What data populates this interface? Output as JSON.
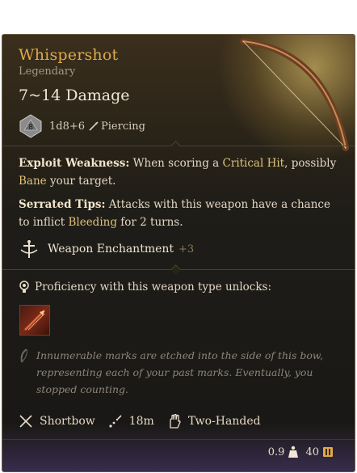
{
  "item": {
    "name": "Whispershot",
    "rarity": "Legendary",
    "damage_range": "7~14 Damage",
    "dice_face": "8",
    "dice_formula": "1d8+6",
    "damage_type": "Piercing"
  },
  "effects": {
    "exploit": {
      "label": "Exploit Weakness:",
      "text_1": " When scoring a ",
      "critical": "Critical Hit",
      "text_2": ", possibly ",
      "bane": "Bane",
      "text_3": " your target."
    },
    "serrated": {
      "label": "Serrated Tips:",
      "text_1": " Attacks with this weapon have a chance to inflict ",
      "bleeding": "Bleeding",
      "text_2": " for 2 turns."
    },
    "enchantment": {
      "label": "Weapon Enchantment",
      "value": "+3"
    }
  },
  "proficiency": {
    "label": "Proficiency with this weapon type unlocks:"
  },
  "lore": "Innumerable marks are etched into the side of this bow, representing each of your past marks. Eventually, you stopped counting.",
  "properties": {
    "type": "Shortbow",
    "range": "18m",
    "handedness": "Two-Handed"
  },
  "footer": {
    "weight": "0.9",
    "value": "40"
  },
  "colors": {
    "title": "#e0a94a",
    "keyword": "#e3c27a",
    "background": "#1b1a17"
  }
}
